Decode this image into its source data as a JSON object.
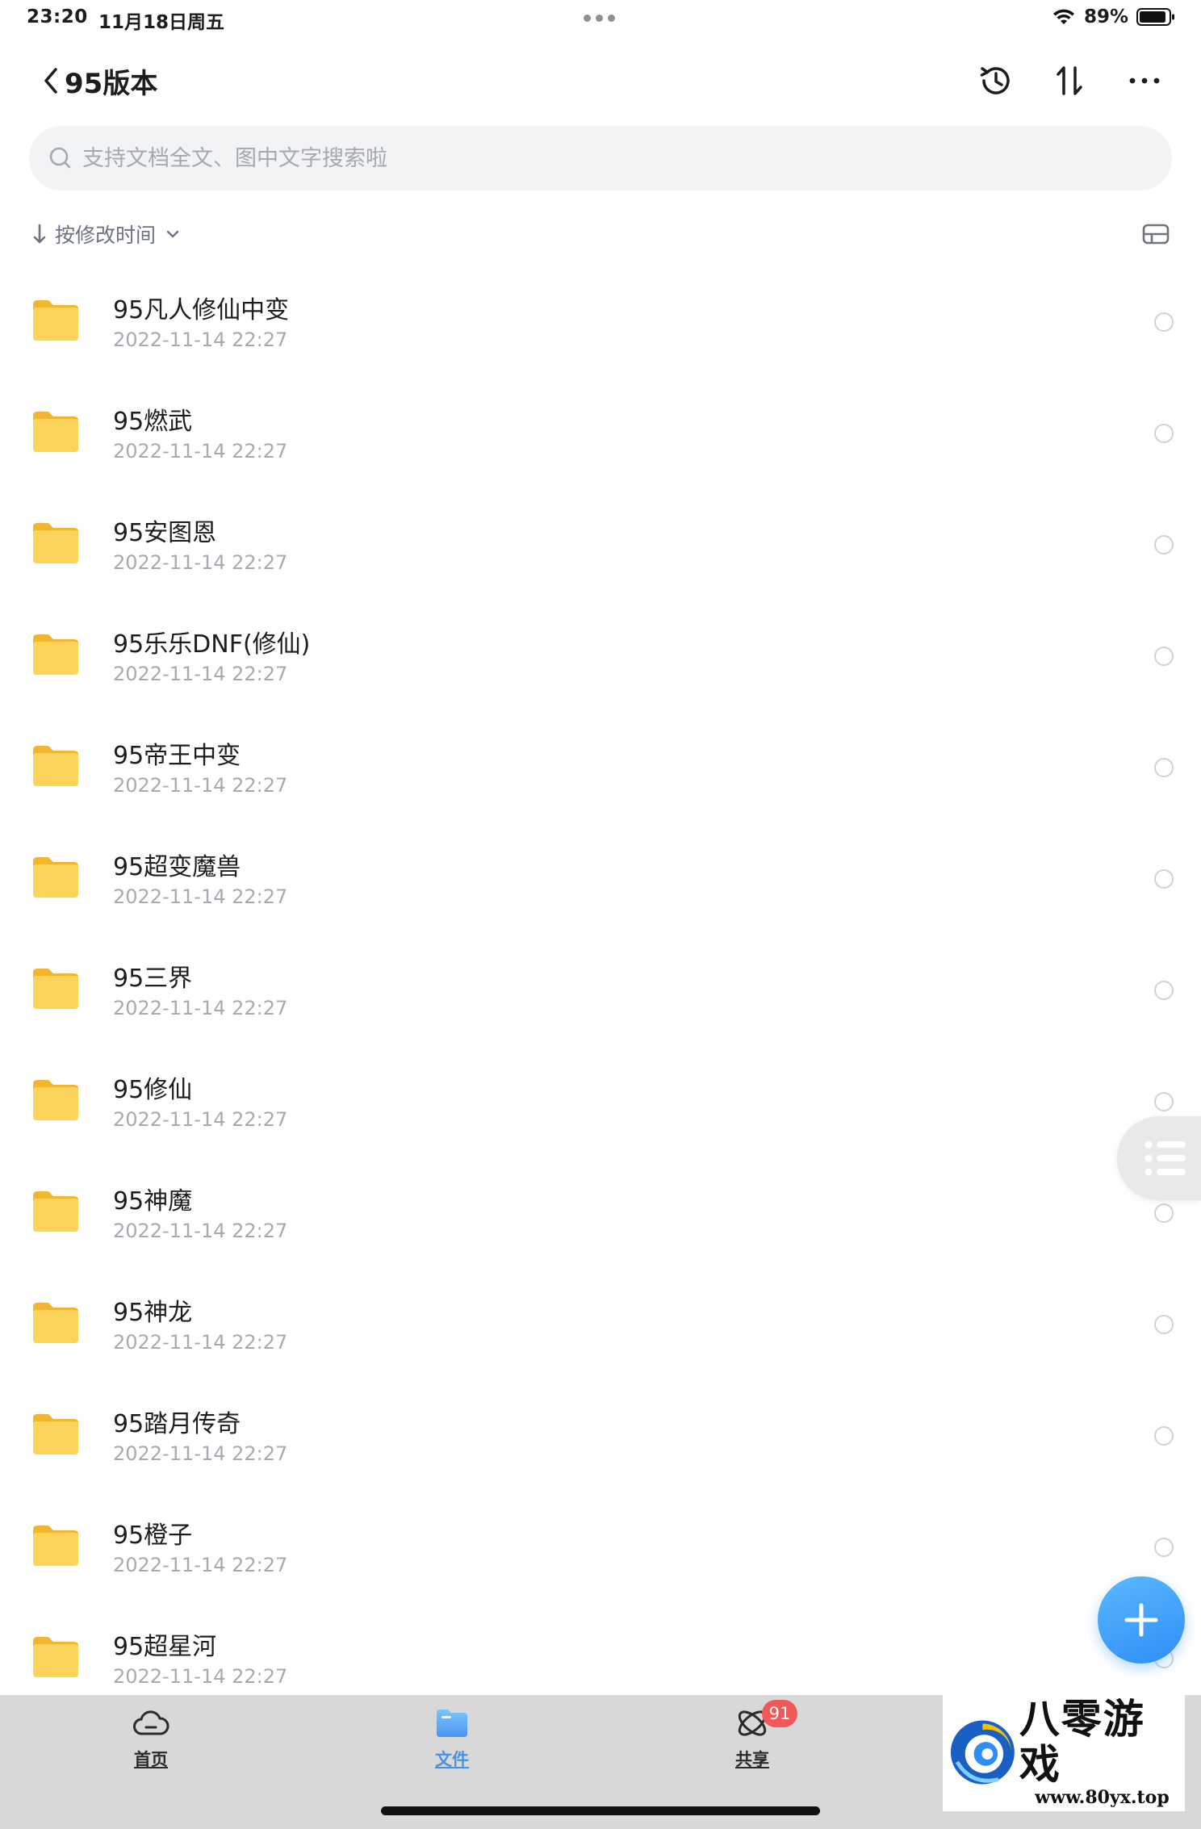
{
  "status_bar": {
    "time": "23:20",
    "date": "11月18日周五",
    "battery": "89%"
  },
  "nav": {
    "title": "95版本"
  },
  "search": {
    "placeholder": "支持文档全文、图中文字搜索啦"
  },
  "sort": {
    "label": "按修改时间"
  },
  "files": [
    {
      "name": "95凡人修仙中变",
      "date": "2022-11-14 22:27"
    },
    {
      "name": "95燃武",
      "date": "2022-11-14 22:27"
    },
    {
      "name": "95安图恩",
      "date": "2022-11-14 22:27"
    },
    {
      "name": "95乐乐DNF(修仙)",
      "date": "2022-11-14 22:27"
    },
    {
      "name": "95帝王中变",
      "date": "2022-11-14 22:27"
    },
    {
      "name": "95超变魔兽",
      "date": "2022-11-14 22:27"
    },
    {
      "name": "95三界",
      "date": "2022-11-14 22:27"
    },
    {
      "name": "95修仙",
      "date": "2022-11-14 22:27"
    },
    {
      "name": "95神魔",
      "date": "2022-11-14 22:27"
    },
    {
      "name": "95神龙",
      "date": "2022-11-14 22:27"
    },
    {
      "name": "95踏月传奇",
      "date": "2022-11-14 22:27"
    },
    {
      "name": "95橙子",
      "date": "2022-11-14 22:27"
    },
    {
      "name": "95超星河",
      "date": "2022-11-14 22:27"
    }
  ],
  "tabs": {
    "home": "首页",
    "files": "文件",
    "share": "共享",
    "share_badge": "91"
  },
  "watermark": {
    "title": "八零游戏",
    "url": "www.80yx.top"
  },
  "colors": {
    "accent": "#4a90e2",
    "folder": "#fbd25c",
    "badge": "#f25858",
    "tab_bar": "#d8d8d8"
  }
}
